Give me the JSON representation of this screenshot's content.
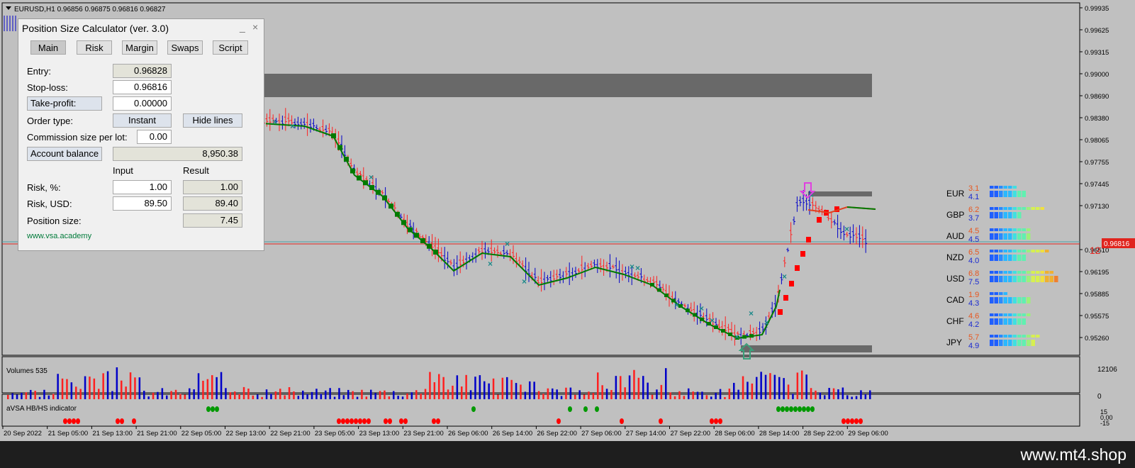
{
  "header": {
    "symbol_line": "EURUSD,H1  0.96856 0.96875 0.96816 0.96827"
  },
  "price_axis": {
    "labels": [
      "0.99935",
      "0.99625",
      "0.99315",
      "0.99000",
      "0.98690",
      "0.98380",
      "0.98065",
      "0.97755",
      "0.97445",
      "0.97130",
      "0.96816",
      "0.96510",
      "0.96195",
      "0.95885",
      "0.95575",
      "0.95260"
    ],
    "current_price": "0.96816",
    "spread": "12"
  },
  "volume_pane": {
    "title": "Volumes 535",
    "max_label": "12106",
    "min_label": "0"
  },
  "indicator_pane": {
    "title": "aVSA HB/HS indicator",
    "labels": [
      "15",
      "0,00",
      "-15"
    ]
  },
  "time_axis": {
    "labels": [
      "20 Sep 2022",
      "21 Sep 05:00",
      "21 Sep 13:00",
      "21 Sep 21:00",
      "22 Sep 05:00",
      "22 Sep 13:00",
      "22 Sep 21:00",
      "23 Sep 05:00",
      "23 Sep 13:00",
      "23 Sep 21:00",
      "26 Sep 06:00",
      "26 Sep 14:00",
      "26 Sep 22:00",
      "27 Sep 06:00",
      "27 Sep 14:00",
      "27 Sep 22:00",
      "28 Sep 06:00",
      "28 Sep 14:00",
      "28 Sep 22:00",
      "29 Sep 06:00"
    ]
  },
  "currency_strength": [
    {
      "name": "EUR",
      "v1": "3.1",
      "v2": "4.1"
    },
    {
      "name": "GBP",
      "v1": "6.2",
      "v2": "3.7"
    },
    {
      "name": "AUD",
      "v1": "4.5",
      "v2": "4.5"
    },
    {
      "name": "NZD",
      "v1": "6.5",
      "v2": "4.0"
    },
    {
      "name": "USD",
      "v1": "6.8",
      "v2": "7.5"
    },
    {
      "name": "CAD",
      "v1": "1.9",
      "v2": "4.3"
    },
    {
      "name": "CHF",
      "v1": "4.6",
      "v2": "4.2"
    },
    {
      "name": "JPY",
      "v1": "5.7",
      "v2": "4.9"
    }
  ],
  "calculator": {
    "title": "Position Size Calculator (ver. 3.0)",
    "minimize": "_",
    "close": "×",
    "tabs": [
      "Main",
      "Risk",
      "Margin",
      "Swaps",
      "Script"
    ],
    "entry_label": "Entry:",
    "entry_value": "0.96828",
    "stoploss_label": "Stop-loss:",
    "stoploss_value": "0.96816",
    "takeprofit_button": "Take-profit:",
    "takeprofit_value": "0.00000",
    "order_type_label": "Order type:",
    "order_type_button": "Instant",
    "hide_lines_button": "Hide lines",
    "commission_label": "Commission size per lot:",
    "commission_value": "0.00",
    "account_balance_button": "Account balance",
    "account_balance_value": "8,950.38",
    "input_header": "Input",
    "result_header": "Result",
    "risk_pct_label": "Risk, %:",
    "risk_pct_input": "1.00",
    "risk_pct_result": "1.00",
    "risk_usd_label": "Risk, USD:",
    "risk_usd_input": "89.50",
    "risk_usd_result": "89.40",
    "position_size_label": "Position size:",
    "position_size_result": "7.45",
    "website": "www.vsa.academy"
  },
  "footer": {
    "brand": "www.mt4.shop"
  },
  "colors": {
    "bull": "#0000c8",
    "bear": "#ff2020",
    "ma_green": "#007a00",
    "ma_red": "#ff0000",
    "band": "#696969",
    "price_line": "#e0241e",
    "current_tag": "#e0241e"
  }
}
